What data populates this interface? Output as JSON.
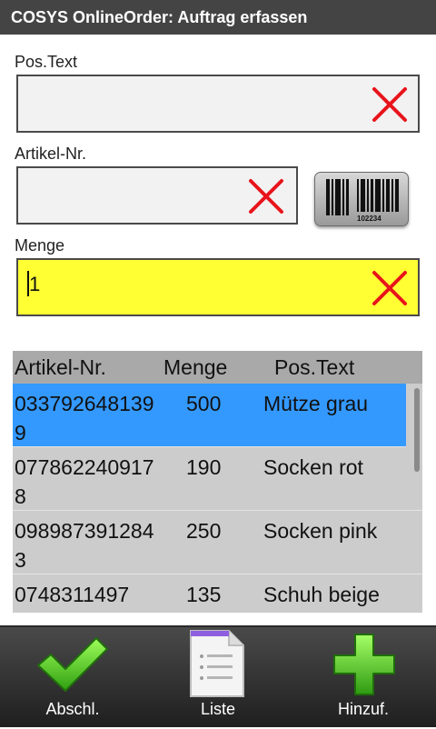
{
  "app": {
    "title": "COSYS OnlineOrder: Auftrag erfassen"
  },
  "form": {
    "pos_text": {
      "label": "Pos.Text",
      "value": ""
    },
    "artikel_nr": {
      "label": "Artikel-Nr.",
      "value": ""
    },
    "menge": {
      "label": "Menge",
      "value": "1"
    },
    "barcode_digits": "102234",
    "clear_icon": "red-x-icon",
    "barcode_icon": "barcode-icon",
    "accent_yellow": "#ffff33",
    "clear_color": "#e8141b"
  },
  "list": {
    "headers": [
      "Artikel-Nr.",
      "Menge",
      "Pos.Text"
    ],
    "rows": [
      {
        "artikel": "0337926481399",
        "menge": "500",
        "text": "Mütze grau"
      },
      {
        "artikel": "0778622409178",
        "menge": "190",
        "text": "Socken rot"
      },
      {
        "artikel": "0989873912843",
        "menge": "250",
        "text": "Socken pink"
      },
      {
        "artikel": "0748311497",
        "menge": "135",
        "text": "Schuh beige"
      }
    ],
    "selected_color": "#3399ff"
  },
  "toolbar": {
    "finish_label": "Abschl.",
    "list_label": "Liste",
    "add_label": "Hinzuf.",
    "finish_icon": "green-check-icon",
    "list_icon": "document-list-icon",
    "add_icon": "green-plus-icon"
  }
}
